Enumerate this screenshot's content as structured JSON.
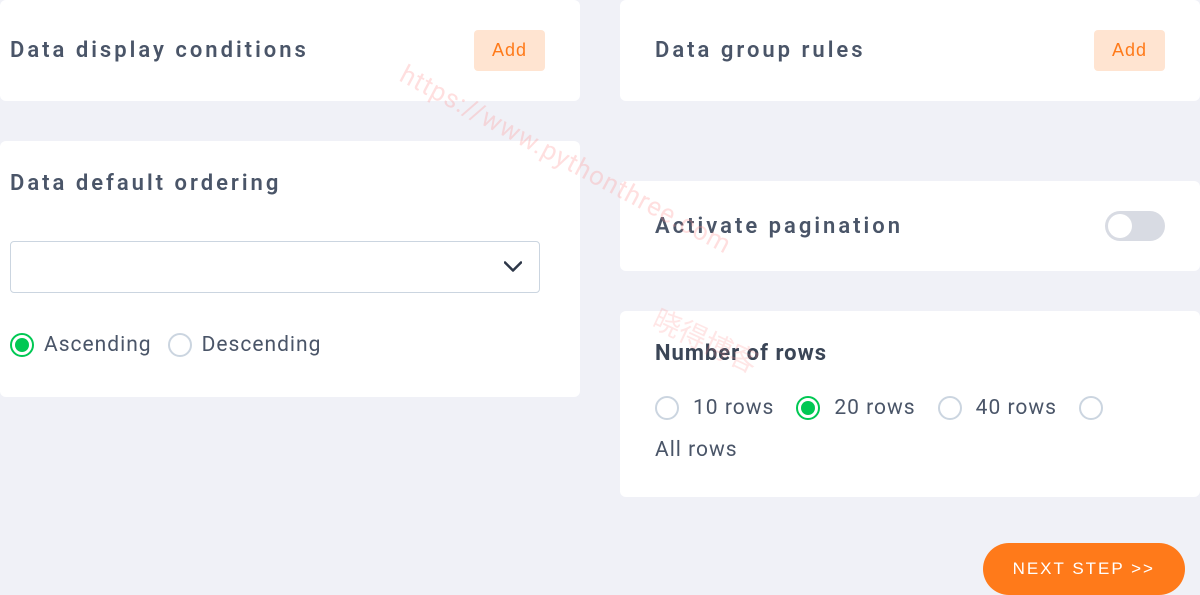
{
  "conditions": {
    "title": "Data display conditions",
    "add_label": "Add"
  },
  "group_rules": {
    "title": "Data group rules",
    "add_label": "Add"
  },
  "ordering": {
    "title": "Data default ordering",
    "select_value": "",
    "asc_label": "Ascending",
    "desc_label": "Descending",
    "selected": "asc"
  },
  "pagination": {
    "title": "Activate pagination",
    "enabled": false
  },
  "rows": {
    "title": "Number of rows",
    "options": [
      "10 rows",
      "20 rows",
      "40 rows"
    ],
    "selected": "20 rows",
    "all_label": "All rows"
  },
  "next_label": "NEXT STEP >>",
  "watermark1": "https://www.pythonthree.com",
  "watermark2": "晓得博客"
}
